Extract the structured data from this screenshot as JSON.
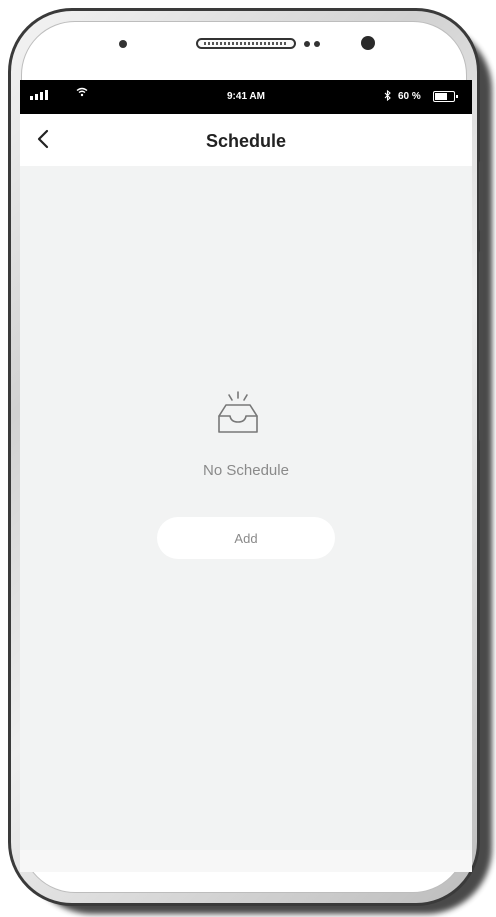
{
  "status_bar": {
    "time": "9:41 AM",
    "battery_percent": "60 %",
    "signal_icon": "signal-bars-icon",
    "wifi_icon": "wifi-icon",
    "bluetooth_icon": "bluetooth-icon",
    "battery_icon": "battery-icon"
  },
  "nav": {
    "back_icon": "chevron-left-icon",
    "title": "Schedule"
  },
  "empty_state": {
    "icon": "empty-inbox-icon",
    "message": "No Schedule",
    "add_label": "Add"
  },
  "colors": {
    "screen_background": "#f2f3f3",
    "status_bar": "#000000",
    "title_text": "#222222",
    "muted_text": "#8a8a8a"
  }
}
